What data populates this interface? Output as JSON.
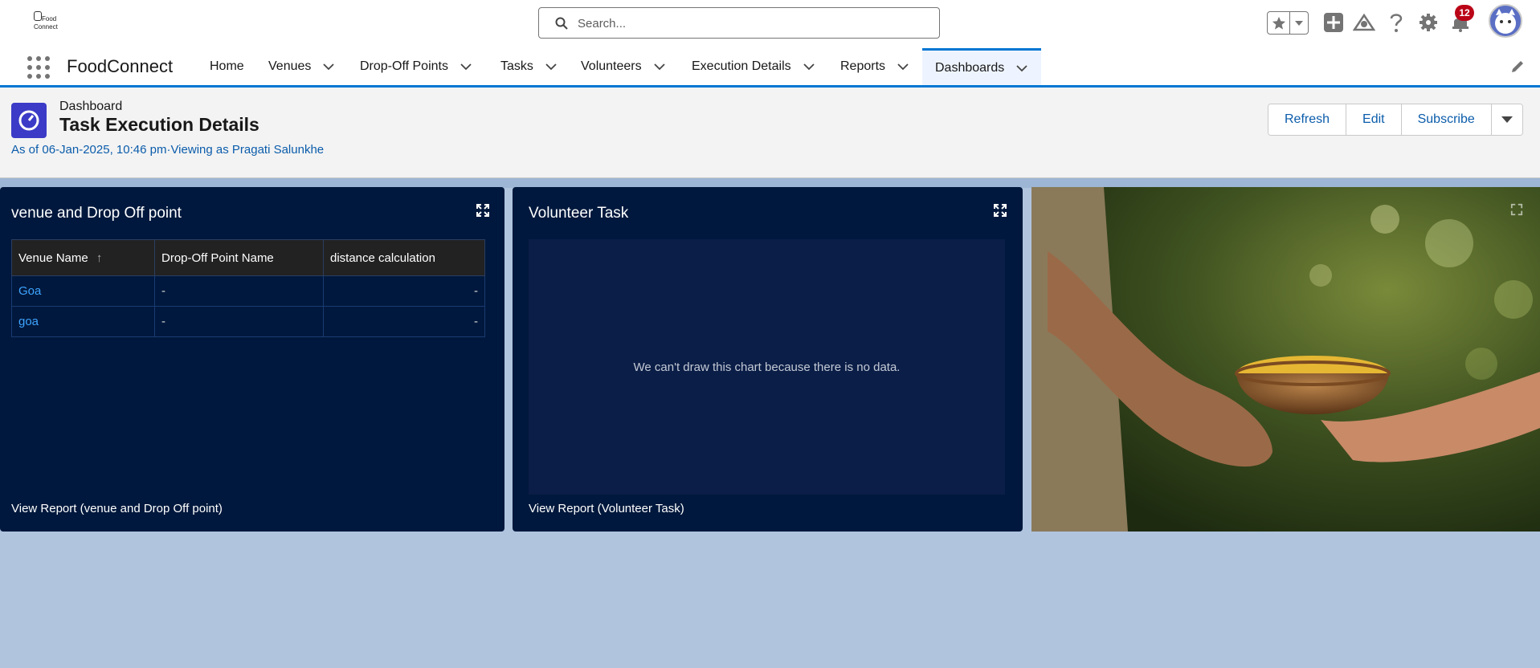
{
  "header": {
    "logo_line1": "Food",
    "logo_line2": "Connect",
    "search_placeholder": "Search...",
    "notifications_count": "12"
  },
  "nav": {
    "app_name": "FoodConnect",
    "items": [
      {
        "label": "Home"
      },
      {
        "label": "Venues"
      },
      {
        "label": "Drop-Off Points"
      },
      {
        "label": "Tasks"
      },
      {
        "label": "Volunteers"
      },
      {
        "label": "Execution Details"
      },
      {
        "label": "Reports"
      },
      {
        "label": "Dashboards"
      }
    ],
    "active": "Dashboards"
  },
  "page": {
    "entity": "Dashboard",
    "title": "Task Execution Details",
    "subtitle": "As of 06-Jan-2025, 10:46 pm·Viewing as Pragati Salunkhe",
    "buttons": {
      "refresh": "Refresh",
      "edit": "Edit",
      "subscribe": "Subscribe"
    }
  },
  "widgets": {
    "venue": {
      "title": "venue and Drop Off point",
      "columns": [
        "Venue Name",
        "Drop-Off Point Name",
        "distance calculation"
      ],
      "sort_indicator": "↑",
      "rows": [
        {
          "venue": "Goa",
          "dropoff": "-",
          "distance": "-"
        },
        {
          "venue": "goa",
          "dropoff": "-",
          "distance": "-"
        }
      ],
      "footer": "View Report (venue and Drop Off point)"
    },
    "volunteer": {
      "title": "Volunteer Task",
      "empty_message": "We can't draw this chart because there is no data.",
      "footer": "View Report (Volunteer Task)"
    }
  },
  "colors": {
    "brand_blue": "#0176d3",
    "card_bg": "#00183d",
    "canvas_bg": "#b0c4de",
    "link": "#3ea4ff",
    "badge": "#ba0517"
  }
}
